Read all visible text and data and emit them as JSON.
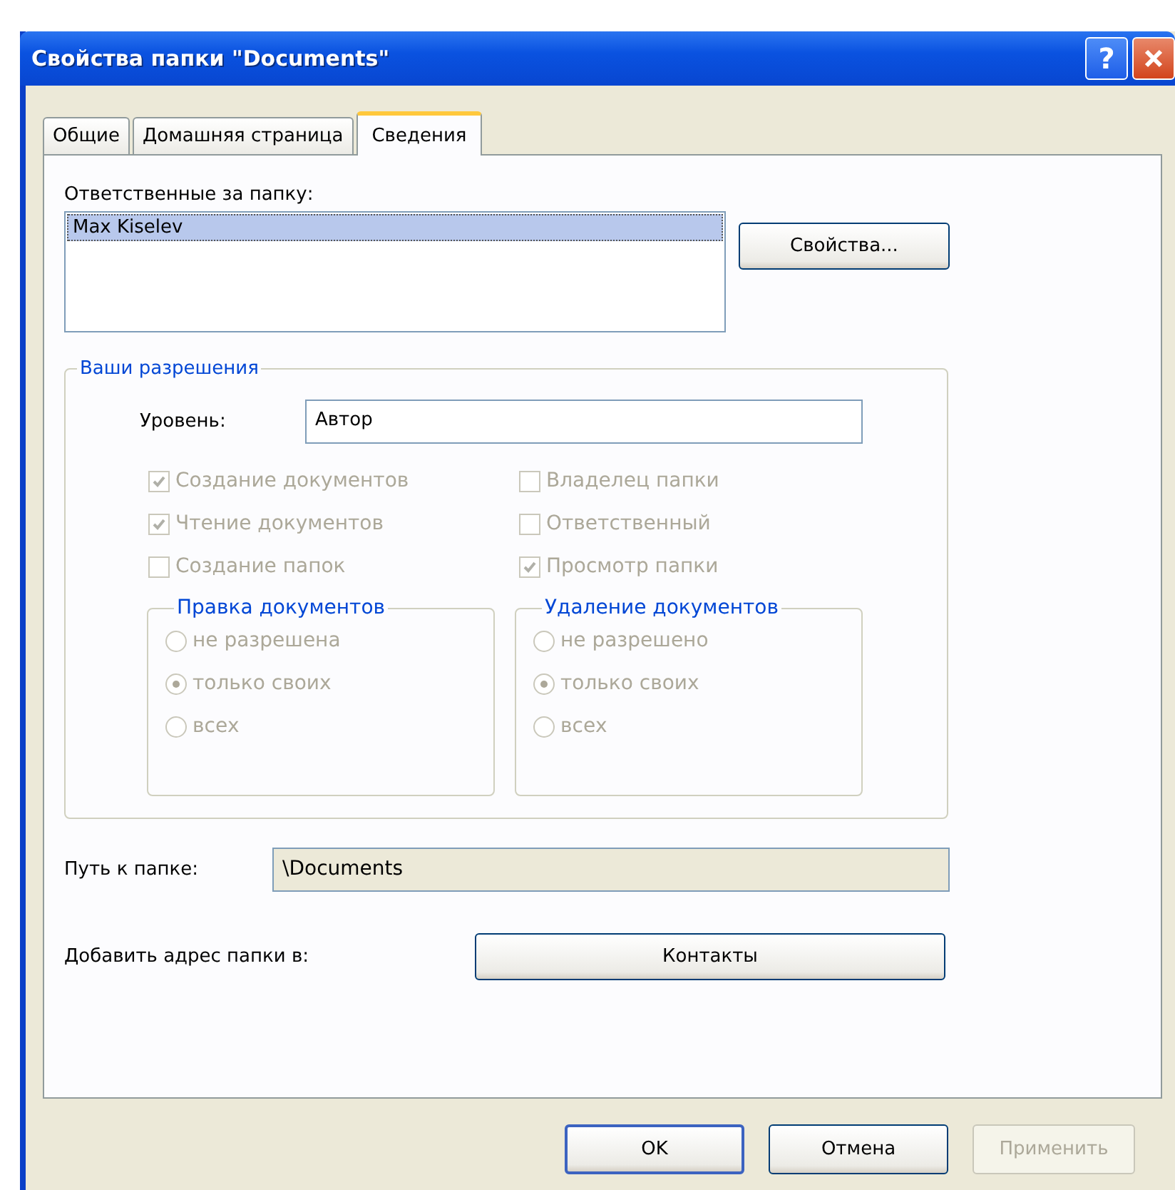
{
  "window": {
    "title": "Свойства папки \"Documents\"",
    "help": "?"
  },
  "tabs": [
    {
      "label": "Общие",
      "selected": false
    },
    {
      "label": "Домашняя страница",
      "selected": false
    },
    {
      "label": "Сведения",
      "selected": true
    }
  ],
  "owners": {
    "label": "Ответственные за папку:",
    "items": [
      {
        "name": "Max Kiselev",
        "selected": true
      }
    ],
    "button": "Свойства..."
  },
  "permissions": {
    "title": "Ваши разрешения",
    "disabled": true,
    "level_label": "Уровень:",
    "level_value": "Автор",
    "checkbox_columns": [
      [
        {
          "label": "Создание документов",
          "checked": true
        },
        {
          "label": "Чтение документов",
          "checked": true
        },
        {
          "label": "Создание папок",
          "checked": false
        }
      ],
      [
        {
          "label": "Владелец папки",
          "checked": false
        },
        {
          "label": "Ответственный",
          "checked": false
        },
        {
          "label": "Просмотр папки",
          "checked": true
        }
      ]
    ],
    "radio_groups": [
      {
        "title": "Правка документов",
        "options": [
          {
            "label": "не разрешена",
            "selected": false
          },
          {
            "label": "только своих",
            "selected": true
          },
          {
            "label": "всех",
            "selected": false
          }
        ]
      },
      {
        "title": "Удаление документов",
        "options": [
          {
            "label": "не разрешено",
            "selected": false
          },
          {
            "label": "только своих",
            "selected": true
          },
          {
            "label": "всех",
            "selected": false
          }
        ]
      }
    ]
  },
  "path": {
    "label": "Путь к папке:",
    "value": "\\Documents"
  },
  "add_address": {
    "label": "Добавить адрес папки в:",
    "button": "Контакты"
  },
  "buttons": [
    {
      "label": "OK",
      "default": true,
      "disabled": false
    },
    {
      "label": "Отмена",
      "default": false,
      "disabled": false
    },
    {
      "label": "Применить",
      "default": false,
      "disabled": true
    }
  ]
}
